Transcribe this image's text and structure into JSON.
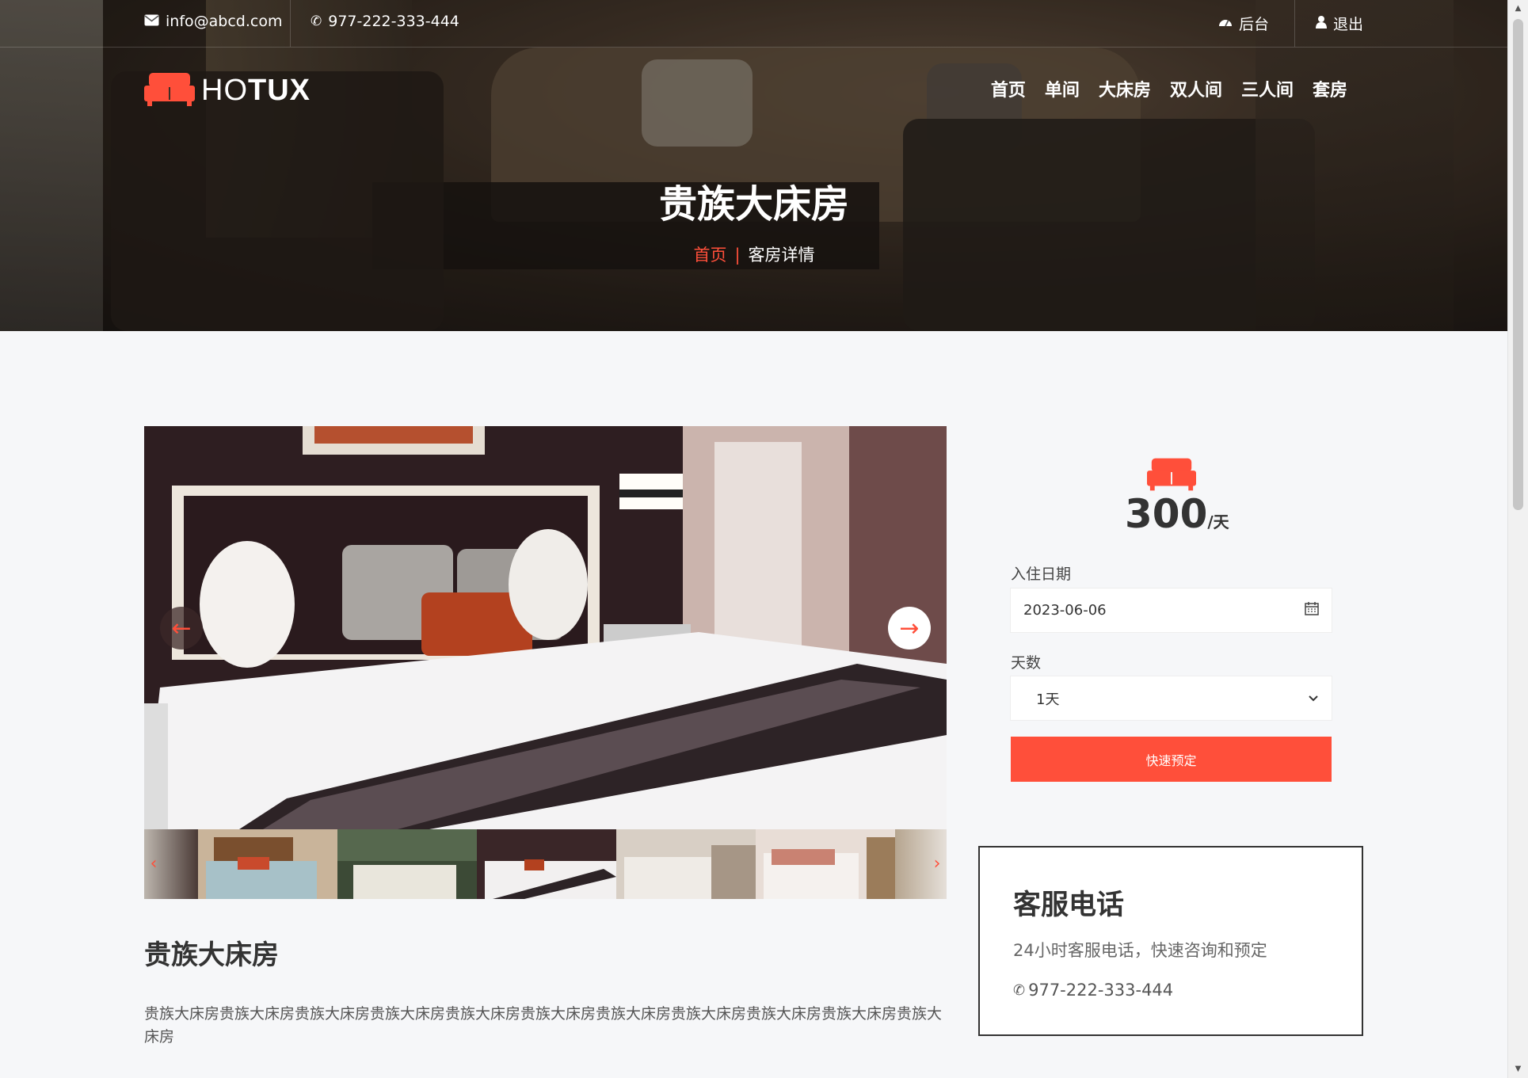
{
  "topbar": {
    "email": "info@abcd.com",
    "phone": "977-222-333-444",
    "admin": "后台",
    "logout": "退出"
  },
  "logo": {
    "part1": "HO",
    "part2": "TUX"
  },
  "nav": [
    "首页",
    "单间",
    "大床房",
    "双人间",
    "三人间",
    "套房"
  ],
  "hero": {
    "title": "贵族大床房"
  },
  "breadcrumb": {
    "home": "首页",
    "separator": "|",
    "current": "客房详情"
  },
  "room": {
    "title": "贵族大床房",
    "description": "贵族大床房贵族大床房贵族大床房贵族大床房贵族大床房贵族大床房贵族大床房贵族大床房贵族大床房贵族大床房贵族大床房"
  },
  "booking": {
    "price": "300",
    "unit": "/天",
    "checkin_label": "入住日期",
    "checkin_value": "2023-06-06",
    "days_label": "天数",
    "days_value": "1天",
    "button": "快速预定"
  },
  "service": {
    "title": "客服电话",
    "desc": "24小时客服电话，快速咨询和预定",
    "phone": "977-222-333-444"
  },
  "colors": {
    "accent": "#ff4f3a",
    "text": "#333333"
  }
}
